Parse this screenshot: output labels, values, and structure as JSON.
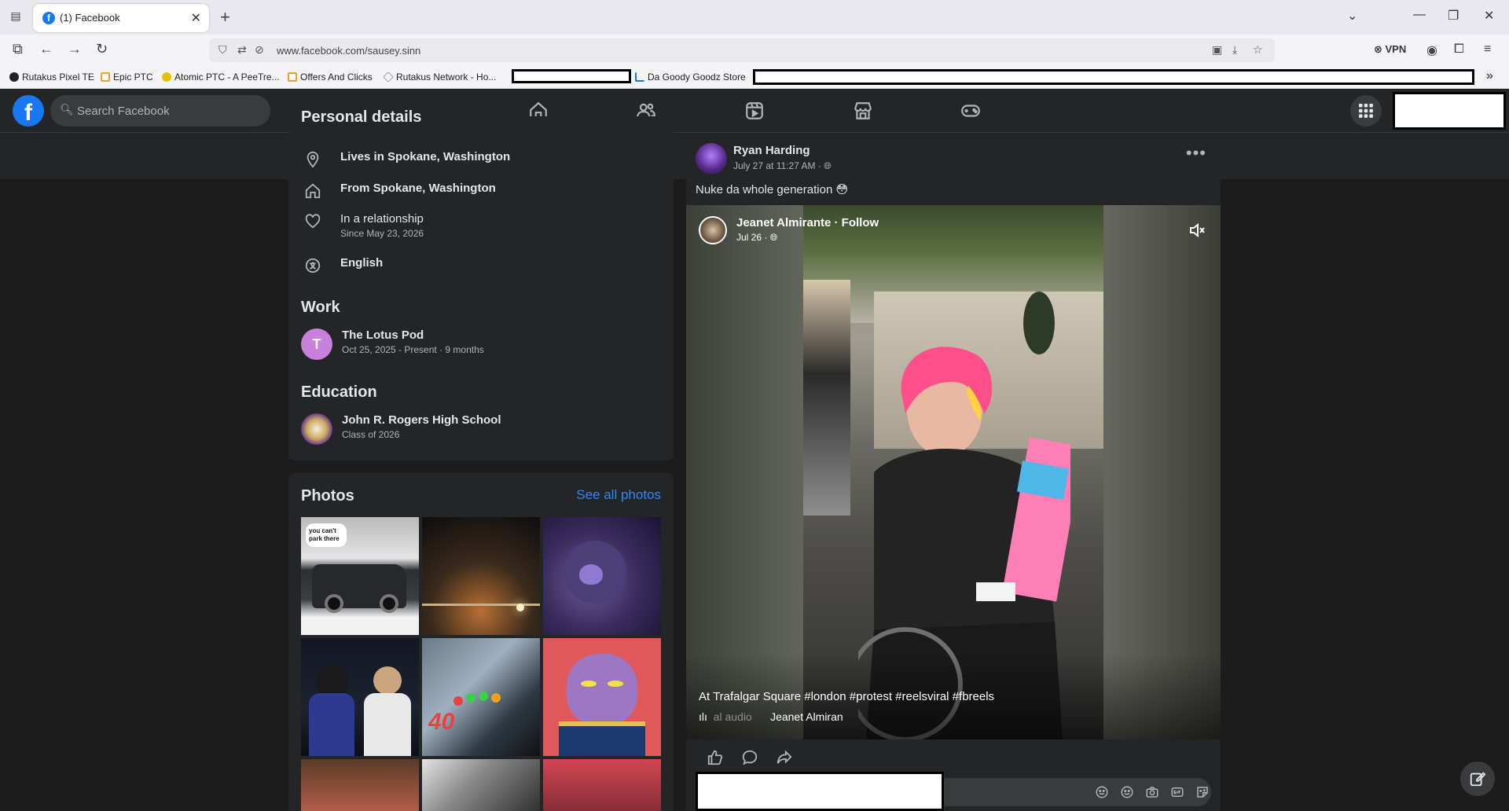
{
  "browser": {
    "tab_title": "(1) Facebook",
    "tab_favicon": "f",
    "new_tab": "+",
    "url": "www.facebook.com/sausey.sinn",
    "vpn_label": "VPN",
    "bookmarks": [
      {
        "label": "Rutakus Pixel TE",
        "color": "#222222"
      },
      {
        "label": "Epic PTC",
        "color": "#f0a020"
      },
      {
        "label": "Atomic PTC - A PeeTre...",
        "color": "#e8c000"
      },
      {
        "label": "Offers And Clicks",
        "color": "#f0a020"
      },
      {
        "label": "Rutakus Network - Ho...",
        "color": "#888888"
      },
      {
        "label": "Da Goody Goodz Store",
        "color": "#1a73e8"
      }
    ]
  },
  "facebook": {
    "logo": "f",
    "search_placeholder": "Search Facebook"
  },
  "intro": {
    "section_title": "Personal details",
    "details": [
      {
        "icon": "location-icon",
        "text": "Lives in Spokane, Washington",
        "sub": ""
      },
      {
        "icon": "home-icon",
        "text": "From Spokane, Washington",
        "sub": ""
      },
      {
        "icon": "relationship-icon",
        "text": "In a relationship",
        "sub": "Since May 23, 2026"
      },
      {
        "icon": "language-icon",
        "text": "English",
        "sub": ""
      }
    ],
    "work_title": "Work",
    "work": {
      "initial": "T",
      "name": "The Lotus Pod",
      "sub": "Oct 25, 2025 - Present · 9 months"
    },
    "education_title": "Education",
    "education": {
      "name": "John R. Rogers High School",
      "sub": "Class of 2026"
    }
  },
  "photos": {
    "title": "Photos",
    "see_all": "See all photos",
    "thumb1_caption": "you can't park there"
  },
  "post": {
    "author": "Ryan Harding",
    "meta": "July 27 at 11:27 AM · ",
    "text": "Nuke da whole generation 😳",
    "reel": {
      "author": "Jeanet Almirante · Follow",
      "date": "Jul 26 · ",
      "caption": "At Trafalgar Square  #london #protest #reelsviral #fbreels",
      "audio_dim": "al audio",
      "audio_name": "Jeanet Almiran"
    }
  }
}
